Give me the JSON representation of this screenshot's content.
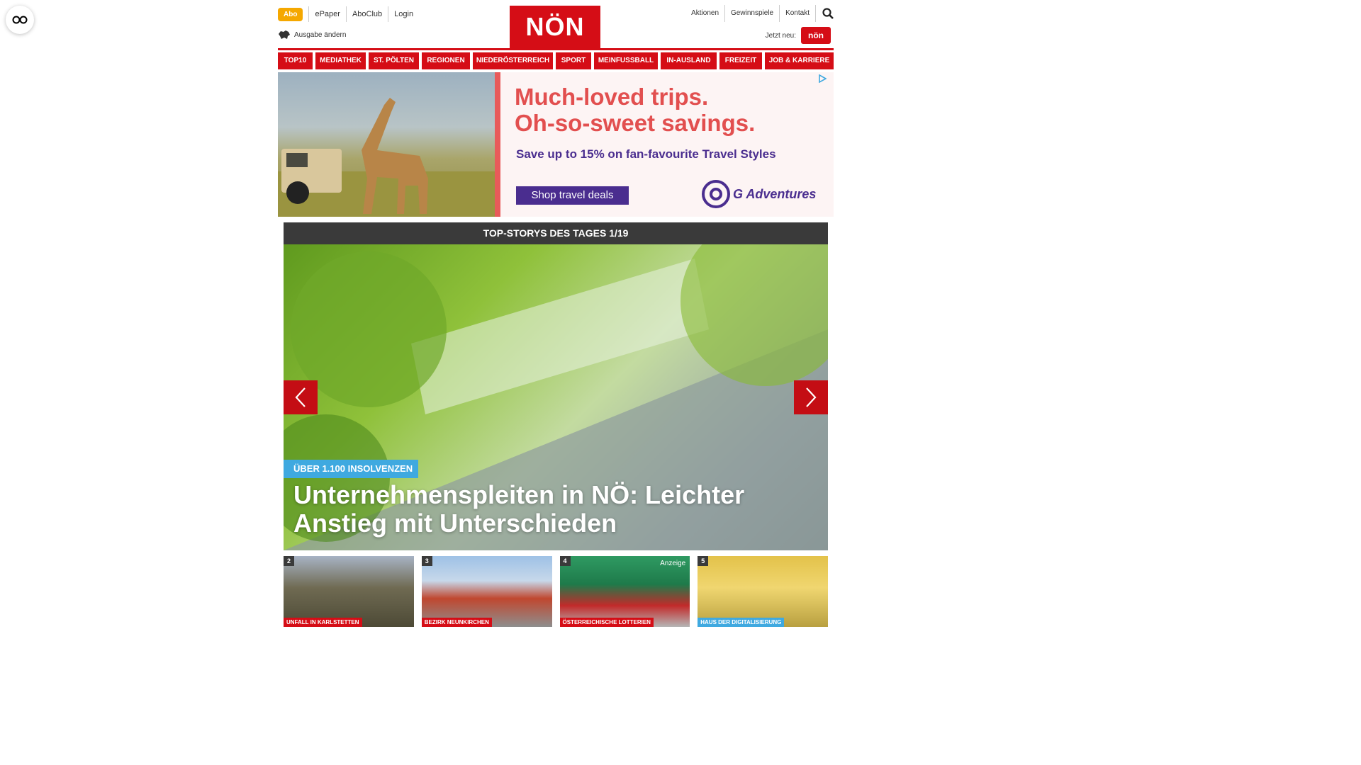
{
  "header": {
    "abo": "Abo",
    "links_left": [
      "ePaper",
      "AboClub",
      "Login"
    ],
    "ausgabe": "Ausgabe ändern",
    "logo": "NÖN",
    "links_right": [
      "Aktionen",
      "Gewinnspiele",
      "Kontakt"
    ],
    "jetzt_neu": "Jetzt neu:",
    "kleine_logo": "nön"
  },
  "nav": [
    "TOP10",
    "MEDIATHEK",
    "ST. PÖLTEN",
    "REGIONEN",
    "NIEDERÖSTERREICH",
    "SPORT",
    "MEINFUSSBALL",
    "IN-AUSLAND",
    "FREIZEIT",
    "JOB & KARRIERE"
  ],
  "ad": {
    "headline_1": "Much-loved trips.",
    "headline_2": "Oh-so-sweet savings.",
    "subline": "Save up to 15% on fan-favourite Travel Styles",
    "button": "Shop travel deals",
    "brand": "G Adventures"
  },
  "slider": {
    "title": "TOP-STORYS DES TAGES 1/19",
    "kicker": "ÜBER 1.100 INSOLVENZEN",
    "headline": "Unternehmenspleiten in NÖ: Leichter Anstieg mit Unterschieden"
  },
  "thumbs": [
    {
      "num": "2",
      "tag": "UNFALL IN KARLSTETTEN",
      "anzeige": ""
    },
    {
      "num": "3",
      "tag": "BEZIRK NEUNKIRCHEN",
      "anzeige": ""
    },
    {
      "num": "4",
      "tag": "ÖSTERREICHISCHE LOTTERIEN",
      "anzeige": "Anzeige"
    },
    {
      "num": "5",
      "tag": "HAUS DER DIGITALISIERUNG",
      "anzeige": ""
    }
  ],
  "colors": {
    "brand_red": "#d50d16",
    "accent_blue": "#3fa9e0",
    "abo_orange": "#f5a800",
    "ad_purple": "#4a2d8f"
  }
}
